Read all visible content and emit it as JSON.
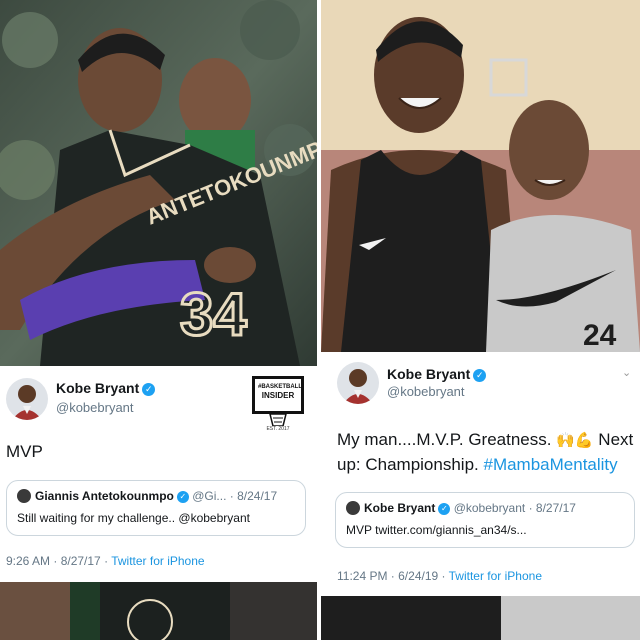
{
  "left": {
    "tweet": {
      "author_name": "Kobe Bryant",
      "author_handle": "@kobebryant",
      "text": "MVP",
      "quote": {
        "author_name": "Giannis Antetokounmpo",
        "author_meta": "@Gi... · 8/24/17",
        "text": "Still waiting for my challenge.. @kobebryant"
      },
      "time": "9:26 AM · 8/27/17 · ",
      "source": "Twitter for iPhone"
    },
    "logo": {
      "line1": "#BASKETBALL",
      "line2": "INSIDER",
      "est": "EST. 2017"
    },
    "photo": {
      "jersey_name": "ANTETOKOUNMPO",
      "jersey_number": "34"
    }
  },
  "right": {
    "tweet": {
      "author_name": "Kobe Bryant",
      "author_handle": "@kobebryant",
      "text_part1": "My man....M.V.P. Greatness. ",
      "emoji": "🙌💪",
      "text_part2": " Next up: Championship. ",
      "hashtag": "#MambaMentality",
      "quote": {
        "author_name": "Kobe Bryant",
        "author_meta": "@kobebryant · 8/27/17",
        "text": "MVP twitter.com/giannis_an34/s..."
      },
      "time": "11:24 PM · 6/24/19 · ",
      "source": "Twitter for iPhone"
    },
    "photo": {
      "shirt_number": "24"
    }
  },
  "colors": {
    "link": "#1b95e0",
    "verified": "#1da1f2",
    "muted": "#657786"
  }
}
